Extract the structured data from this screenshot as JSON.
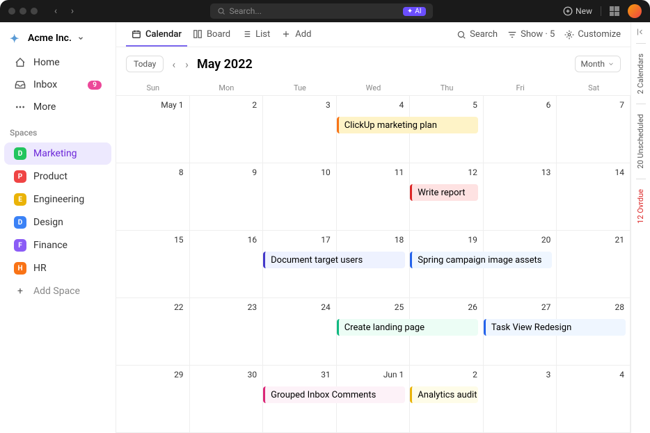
{
  "titlebar": {
    "search_placeholder": "Search...",
    "ai_label": "AI",
    "new_label": "New"
  },
  "workspace": {
    "name": "Acme Inc."
  },
  "sidebar": {
    "items": [
      {
        "label": "Home"
      },
      {
        "label": "Inbox",
        "badge": "9"
      },
      {
        "label": "More"
      }
    ],
    "spaces_heading": "Spaces",
    "spaces": [
      {
        "label": "Marketing",
        "letter": "D",
        "color": "#22c55e",
        "active": true
      },
      {
        "label": "Product",
        "letter": "P",
        "color": "#ef4444"
      },
      {
        "label": "Engineering",
        "letter": "E",
        "color": "#eab308"
      },
      {
        "label": "Design",
        "letter": "D",
        "color": "#3b82f6"
      },
      {
        "label": "Finance",
        "letter": "F",
        "color": "#8b5cf6"
      },
      {
        "label": "HR",
        "letter": "H",
        "color": "#f97316"
      }
    ],
    "add_space": "Add Space"
  },
  "toolbar": {
    "tabs": [
      {
        "label": "Calendar",
        "active": true
      },
      {
        "label": "Board"
      },
      {
        "label": "List"
      },
      {
        "label": "Add"
      }
    ],
    "search": "Search",
    "show": "Show · 5",
    "customize": "Customize"
  },
  "calendar": {
    "today": "Today",
    "title": "May 2022",
    "view": "Month",
    "day_headers": [
      "Sun",
      "Mon",
      "Tue",
      "Wed",
      "Thu",
      "Fri",
      "Sat"
    ],
    "weeks": [
      {
        "dates": [
          "May 1",
          "2",
          "3",
          "4",
          "5",
          "6",
          "7"
        ],
        "events": [
          {
            "label": "ClickUp marketing plan",
            "start": 3,
            "span": 2,
            "bg": "#fef3c7",
            "border": "#f97316"
          }
        ]
      },
      {
        "dates": [
          "8",
          "9",
          "10",
          "11",
          "12",
          "13",
          "14"
        ],
        "events": [
          {
            "label": "Write report",
            "start": 4,
            "span": 1,
            "bg": "#fee2e2",
            "border": "#dc2626"
          }
        ]
      },
      {
        "dates": [
          "15",
          "16",
          "17",
          "18",
          "19",
          "20",
          "21"
        ],
        "events": [
          {
            "label": "Document target users",
            "start": 2,
            "span": 2,
            "bg": "#eef2ff",
            "border": "#4338ca"
          },
          {
            "label": "Spring campaign image assets",
            "start": 4,
            "span": 2,
            "bg": "#eff6ff",
            "border": "#2563eb"
          }
        ]
      },
      {
        "dates": [
          "22",
          "23",
          "24",
          "25",
          "26",
          "27",
          "28"
        ],
        "events": [
          {
            "label": "Create landing page",
            "start": 3,
            "span": 2,
            "bg": "#ecfdf5",
            "border": "#10b981"
          },
          {
            "label": "Task View Redesign",
            "start": 5,
            "span": 2,
            "bg": "#eff6ff",
            "border": "#2563eb"
          }
        ]
      },
      {
        "dates": [
          "29",
          "30",
          "31",
          "Jun 1",
          "2",
          "3",
          "4"
        ],
        "events": [
          {
            "label": "Grouped Inbox Comments",
            "start": 2,
            "span": 2,
            "bg": "#fdf2f8",
            "border": "#db2777"
          },
          {
            "label": "Analytics audit",
            "start": 4,
            "span": 1,
            "bg": "#fefce8",
            "border": "#eab308"
          }
        ]
      }
    ]
  },
  "rail": {
    "calendars": "2 Calendars",
    "unscheduled": "20 Unscheduled",
    "overdue": "12 Ovrdue"
  }
}
